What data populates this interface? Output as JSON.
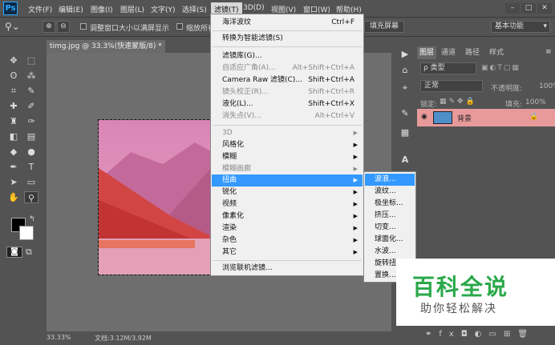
{
  "app": {
    "logo": "Ps",
    "workspace": "基本功能"
  },
  "menubar": {
    "items": [
      "文件(F)",
      "编辑(E)",
      "图像(I)",
      "图层(L)",
      "文字(Y)",
      "选择(S)",
      "滤镜(T)",
      "3D(D)",
      "视图(V)",
      "窗口(W)",
      "帮助(H)"
    ],
    "active_index": 6
  },
  "options_bar": {
    "checkbox1_label": "调整窗口大小以满屏显示",
    "checkbox2_label": "缩放所有",
    "fill_screen_button": "填充屏幕"
  },
  "document": {
    "tab_label": "timg.jpg @ 33.3%(快速蒙版/8) *",
    "zoom": "33.33%",
    "file_info": "文档:3.12M/3.92M"
  },
  "filter_menu": {
    "items": [
      {
        "label": "海洋波纹",
        "shortcut": "Ctrl+F"
      },
      {
        "sep": true
      },
      {
        "label": "转换为智能滤镜(S)"
      },
      {
        "sep": true
      },
      {
        "label": "滤镜库(G)..."
      },
      {
        "label": "自适应广角(A)...",
        "shortcut": "Alt+Shift+Ctrl+A",
        "disabled": true
      },
      {
        "label": "Camera Raw 滤镜(C)...",
        "shortcut": "Shift+Ctrl+A"
      },
      {
        "label": "镜头校正(R)...",
        "shortcut": "Shift+Ctrl+R",
        "disabled": true
      },
      {
        "label": "液化(L)...",
        "shortcut": "Shift+Ctrl+X"
      },
      {
        "label": "消失点(V)...",
        "shortcut": "Alt+Ctrl+V",
        "disabled": true
      },
      {
        "sep": true
      },
      {
        "label": "3D",
        "submenu": true,
        "disabled": true
      },
      {
        "label": "风格化",
        "submenu": true
      },
      {
        "label": "模糊",
        "submenu": true
      },
      {
        "label": "模糊画廊",
        "submenu": true,
        "disabled": true
      },
      {
        "label": "扭曲",
        "submenu": true,
        "highlighted": true
      },
      {
        "label": "锐化",
        "submenu": true
      },
      {
        "label": "视频",
        "submenu": true
      },
      {
        "label": "像素化",
        "submenu": true
      },
      {
        "label": "渲染",
        "submenu": true
      },
      {
        "label": "杂色",
        "submenu": true
      },
      {
        "label": "其它",
        "submenu": true
      },
      {
        "sep": true
      },
      {
        "label": "浏览联机滤镜..."
      }
    ]
  },
  "distort_submenu": {
    "items": [
      "波浪...",
      "波纹...",
      "极坐标...",
      "挤压...",
      "切变...",
      "球面化...",
      "水波...",
      "旋转扭曲...",
      "置换..."
    ],
    "highlighted_index": 0
  },
  "layers_panel": {
    "tabs": [
      "图层",
      "通道",
      "路径",
      "样式"
    ],
    "kind_filter": "ρ 类型",
    "blend_mode": "正常",
    "opacity_label": "不透明度:",
    "opacity_value": "100%",
    "lock_label": "锁定:",
    "fill_label": "填充:",
    "fill_value": "100%",
    "layers": [
      {
        "name": "背景",
        "locked": true,
        "selected": true
      }
    ],
    "bottom_icons": [
      "link-icon",
      "fx-icon",
      "mask-icon",
      "adjustment-icon",
      "group-icon",
      "new-layer-icon",
      "trash-icon"
    ]
  },
  "watermark": {
    "title": "百科全说",
    "subtitle": "助你轻松解决"
  },
  "colors": {
    "highlight": "#3399ff",
    "layer_selected": "#e89a9a",
    "watermark_title": "#2aa84a"
  }
}
